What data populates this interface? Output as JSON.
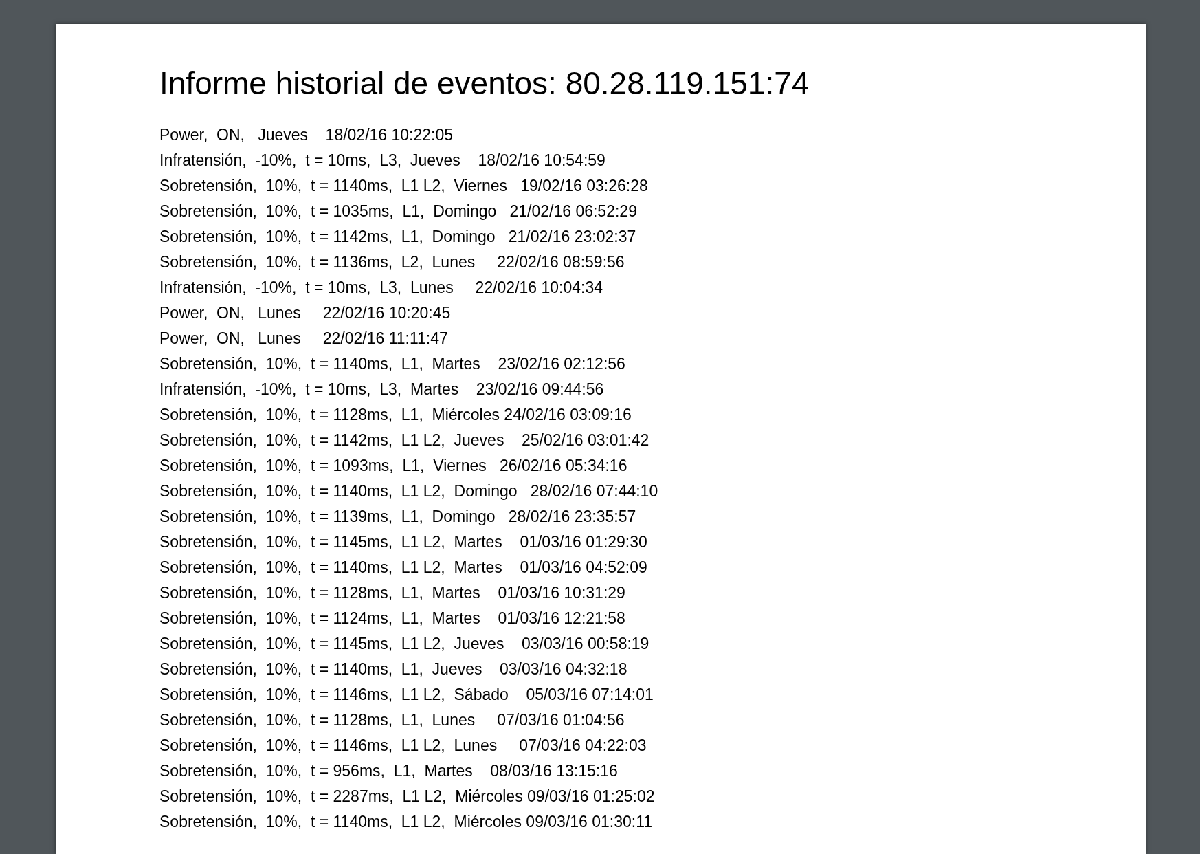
{
  "document": {
    "title": "Informe historial de eventos: 80.28.119.151:74",
    "lines": [
      "Power,  ON,   Jueves    18/02/16 10:22:05",
      "Infratensión,  -10%,  t = 10ms,  L3,  Jueves    18/02/16 10:54:59",
      "Sobretensión,  10%,  t = 1140ms,  L1 L2,  Viernes   19/02/16 03:26:28",
      "Sobretensión,  10%,  t = 1035ms,  L1,  Domingo   21/02/16 06:52:29",
      "Sobretensión,  10%,  t = 1142ms,  L1,  Domingo   21/02/16 23:02:37",
      "Sobretensión,  10%,  t = 1136ms,  L2,  Lunes     22/02/16 08:59:56",
      "Infratensión,  -10%,  t = 10ms,  L3,  Lunes     22/02/16 10:04:34",
      "Power,  ON,   Lunes     22/02/16 10:20:45",
      "Power,  ON,   Lunes     22/02/16 11:11:47",
      "Sobretensión,  10%,  t = 1140ms,  L1,  Martes    23/02/16 02:12:56",
      "Infratensión,  -10%,  t = 10ms,  L3,  Martes    23/02/16 09:44:56",
      "Sobretensión,  10%,  t = 1128ms,  L1,  Miércoles 24/02/16 03:09:16",
      "Sobretensión,  10%,  t = 1142ms,  L1 L2,  Jueves    25/02/16 03:01:42",
      "Sobretensión,  10%,  t = 1093ms,  L1,  Viernes   26/02/16 05:34:16",
      "Sobretensión,  10%,  t = 1140ms,  L1 L2,  Domingo   28/02/16 07:44:10",
      "Sobretensión,  10%,  t = 1139ms,  L1,  Domingo   28/02/16 23:35:57",
      "Sobretensión,  10%,  t = 1145ms,  L1 L2,  Martes    01/03/16 01:29:30",
      "Sobretensión,  10%,  t = 1140ms,  L1 L2,  Martes    01/03/16 04:52:09",
      "Sobretensión,  10%,  t = 1128ms,  L1,  Martes    01/03/16 10:31:29",
      "Sobretensión,  10%,  t = 1124ms,  L1,  Martes    01/03/16 12:21:58",
      "Sobretensión,  10%,  t = 1145ms,  L1 L2,  Jueves    03/03/16 00:58:19",
      "Sobretensión,  10%,  t = 1140ms,  L1,  Jueves    03/03/16 04:32:18",
      "Sobretensión,  10%,  t = 1146ms,  L1 L2,  Sábado    05/03/16 07:14:01",
      "Sobretensión,  10%,  t = 1128ms,  L1,  Lunes     07/03/16 01:04:56",
      "Sobretensión,  10%,  t = 1146ms,  L1 L2,  Lunes     07/03/16 04:22:03",
      "Sobretensión,  10%,  t = 956ms,  L1,  Martes    08/03/16 13:15:16",
      "Sobretensión,  10%,  t = 2287ms,  L1 L2,  Miércoles 09/03/16 01:25:02",
      "Sobretensión,  10%,  t = 1140ms,  L1 L2,  Miércoles 09/03/16 01:30:11"
    ]
  }
}
